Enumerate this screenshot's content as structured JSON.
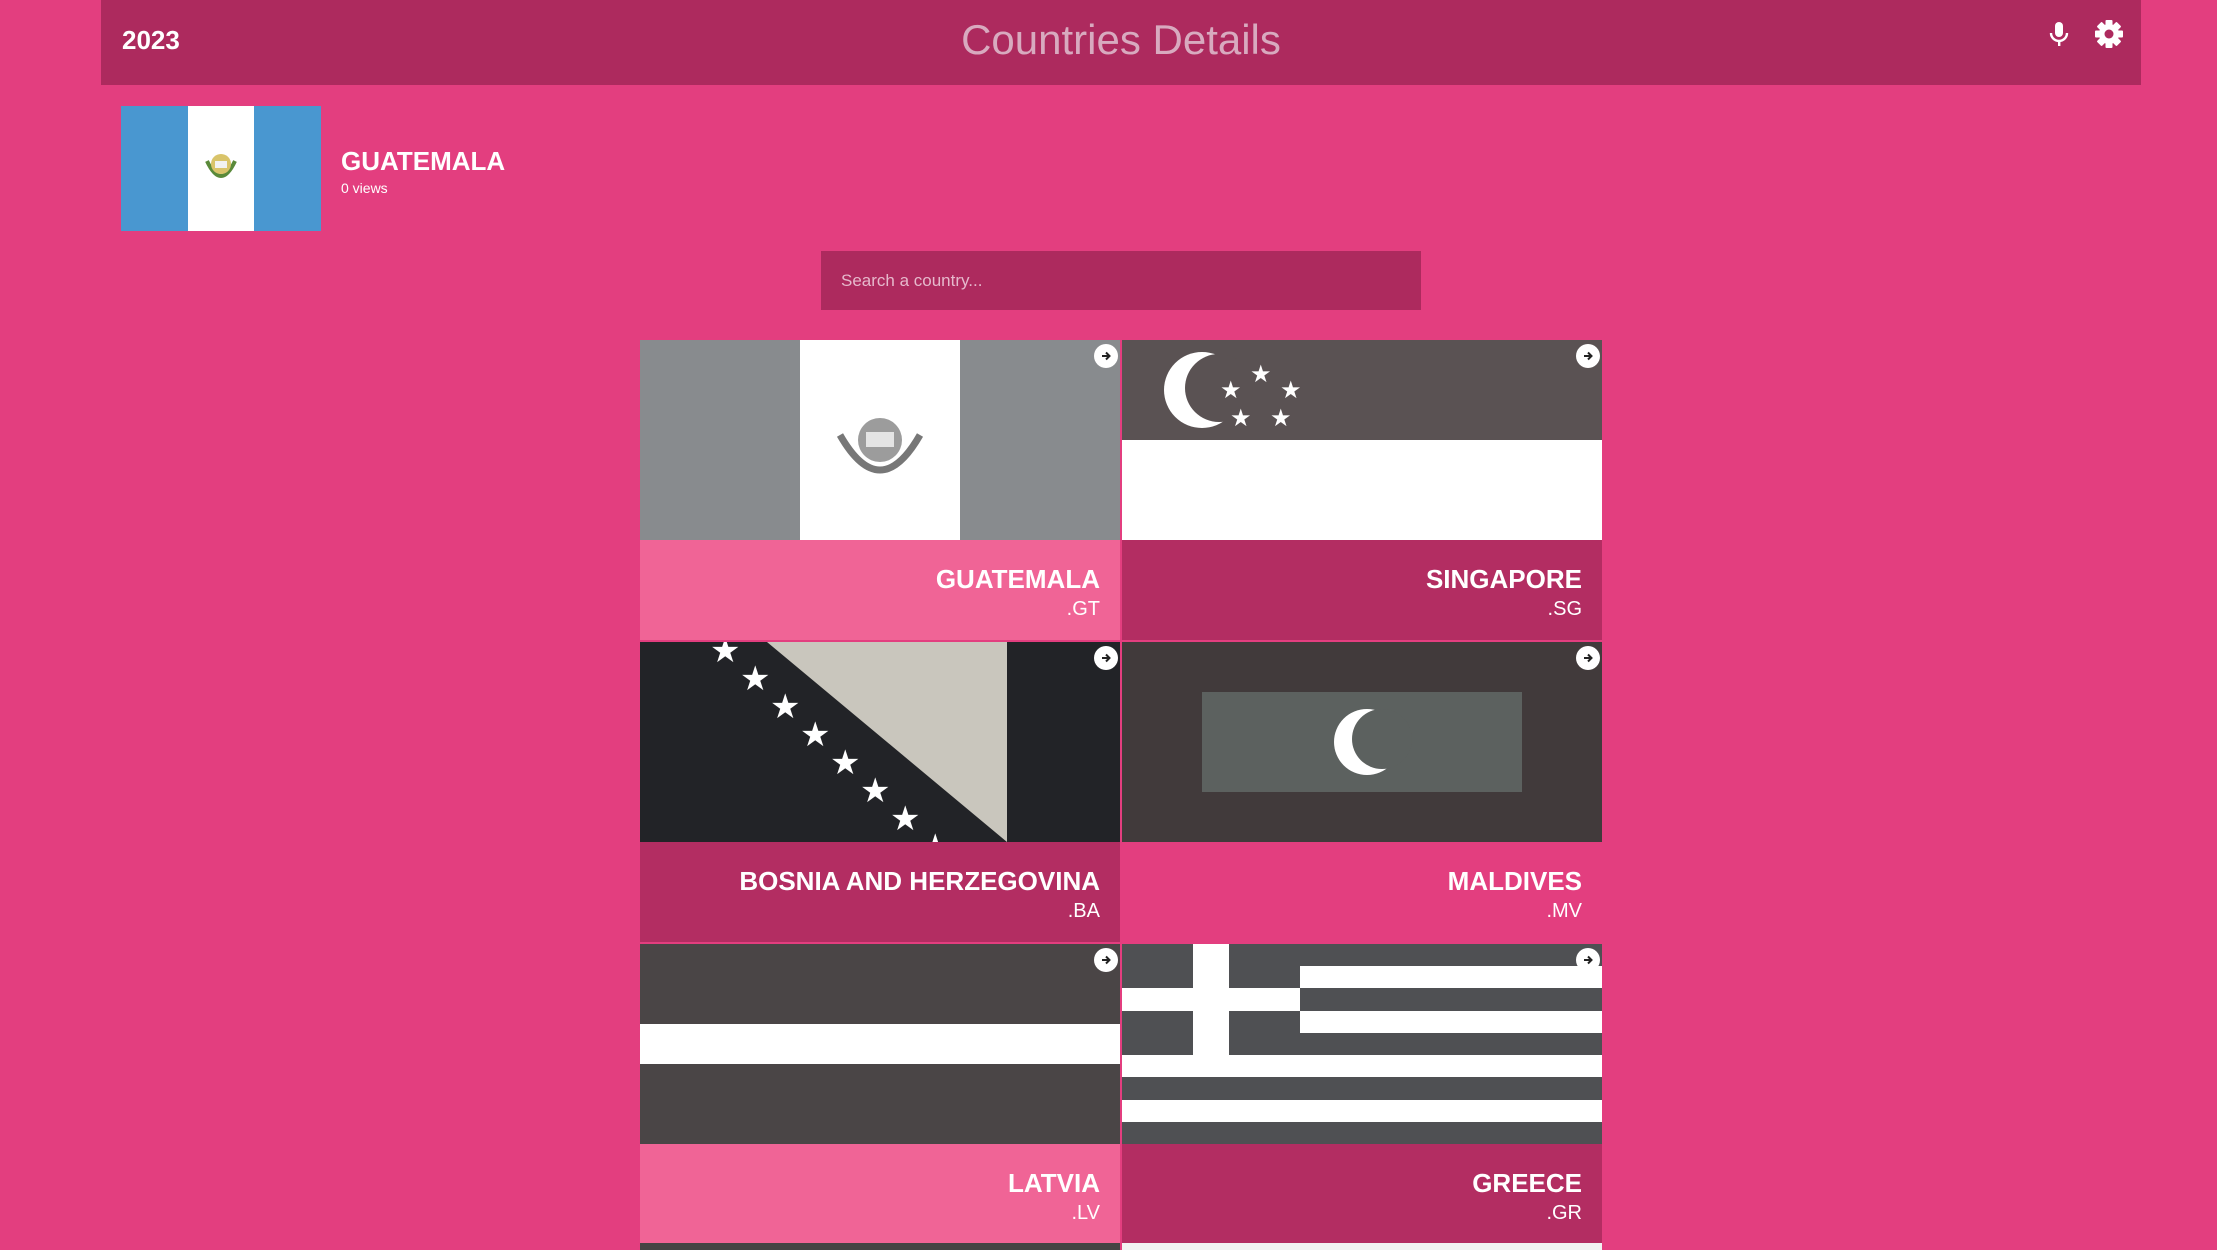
{
  "header": {
    "year": "2023",
    "title": "Countries Details",
    "icons": [
      "microphone-icon",
      "gear-icon"
    ]
  },
  "selected_country": {
    "name": "GUATEMALA",
    "views": "0 views"
  },
  "search": {
    "placeholder": "Search a country..."
  },
  "cards": [
    {
      "name": "GUATEMALA",
      "code": ".GT",
      "footer_color": "#f06496"
    },
    {
      "name": "SINGAPORE",
      "code": ".SG",
      "footer_color": "#b32d62"
    },
    {
      "name": "BOSNIA AND HERZEGOVINA",
      "code": ".BA",
      "footer_color": "#b32d62"
    },
    {
      "name": "MALDIVES",
      "code": ".MV",
      "footer_color": "#e33e7f"
    },
    {
      "name": "LATVIA",
      "code": ".LV",
      "footer_color": "#f06496"
    },
    {
      "name": "GREECE",
      "code": ".GR",
      "footer_color": "#b32d62"
    }
  ],
  "colors": {
    "background": "#e33e7f",
    "header": "#ad2a5e",
    "search_bg": "#ad2a5e"
  }
}
